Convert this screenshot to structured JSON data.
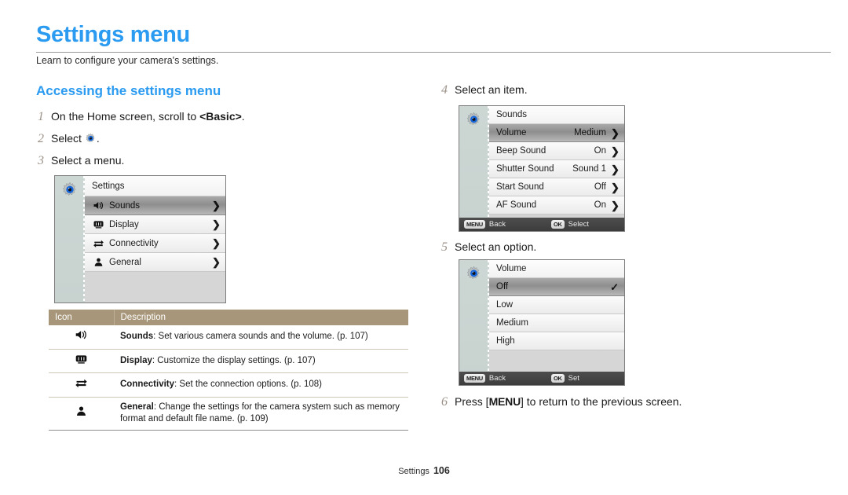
{
  "page": {
    "title": "Settings menu",
    "subtitle": "Learn to configure your camera's settings.",
    "section_heading": "Accessing the settings menu",
    "footer_label": "Settings",
    "footer_page": "106",
    "accent_color": "#2a9bf0",
    "table_header_color": "#a79679",
    "step_number_color": "#9c9288"
  },
  "steps_left": [
    {
      "num": "1",
      "text_before": "On the Home screen, scroll to ",
      "bold": "<Basic>",
      "text_after": "."
    },
    {
      "num": "2",
      "text_before": "Select ",
      "bold": "",
      "text_after": "."
    },
    {
      "num": "3",
      "text_before": "Select a menu.",
      "bold": "",
      "text_after": ""
    }
  ],
  "steps_right": [
    {
      "num": "4",
      "text": "Select an item."
    },
    {
      "num": "5",
      "text": "Select an option."
    },
    {
      "num": "6",
      "text_before": "Press [",
      "key": "MENU",
      "text_after": "] to return to the previous screen."
    }
  ],
  "screens": {
    "settings": {
      "sidebar_icon": "gear-icon",
      "header": "Settings",
      "rows": [
        {
          "icon": "speaker-icon",
          "label": "Sounds",
          "value": "",
          "chevron": "❯",
          "selected": true
        },
        {
          "icon": "display-icon",
          "label": "Display",
          "value": "",
          "chevron": "❯",
          "selected": false
        },
        {
          "icon": "connectivity-icon",
          "label": "Connectivity",
          "value": "",
          "chevron": "❯",
          "selected": false
        },
        {
          "icon": "person-icon",
          "label": "General",
          "value": "",
          "chevron": "❯",
          "selected": false
        }
      ]
    },
    "sounds": {
      "sidebar_icon": "gear-icon",
      "header": "Sounds",
      "rows": [
        {
          "label": "Volume",
          "value": "Medium",
          "chevron": "❯",
          "selected": true
        },
        {
          "label": "Beep Sound",
          "value": "On",
          "chevron": "❯",
          "selected": false
        },
        {
          "label": "Shutter Sound",
          "value": "Sound 1",
          "chevron": "❯",
          "selected": false
        },
        {
          "label": "Start Sound",
          "value": "Off",
          "chevron": "❯",
          "selected": false
        },
        {
          "label": "AF Sound",
          "value": "On",
          "chevron": "❯",
          "selected": false
        }
      ],
      "bottom_bar": {
        "back_key": "MENU",
        "back_label": "Back",
        "ok_key": "OK",
        "ok_label": "Select"
      }
    },
    "volume": {
      "sidebar_icon": "gear-icon",
      "header": "Volume",
      "rows": [
        {
          "label": "Off",
          "check": "✓",
          "selected": true
        },
        {
          "label": "Low",
          "check": "",
          "selected": false
        },
        {
          "label": "Medium",
          "check": "",
          "selected": false
        },
        {
          "label": "High",
          "check": "",
          "selected": false
        }
      ],
      "bottom_bar": {
        "back_key": "MENU",
        "back_label": "Back",
        "ok_key": "OK",
        "ok_label": "Set"
      }
    }
  },
  "table": {
    "columns": [
      "Icon",
      "Description"
    ],
    "rows": [
      {
        "icon": "speaker-icon",
        "bold": "Sounds",
        "text": ": Set various camera sounds and the volume. (p. 107)"
      },
      {
        "icon": "display-icon",
        "bold": "Display",
        "text": ": Customize the display settings. (p. 107)"
      },
      {
        "icon": "connectivity-icon",
        "bold": "Connectivity",
        "text": ": Set the connection options. (p. 108)"
      },
      {
        "icon": "person-icon",
        "bold": "General",
        "text": ": Change the settings for the camera system such as memory format and default file name. (p. 109)"
      }
    ]
  }
}
